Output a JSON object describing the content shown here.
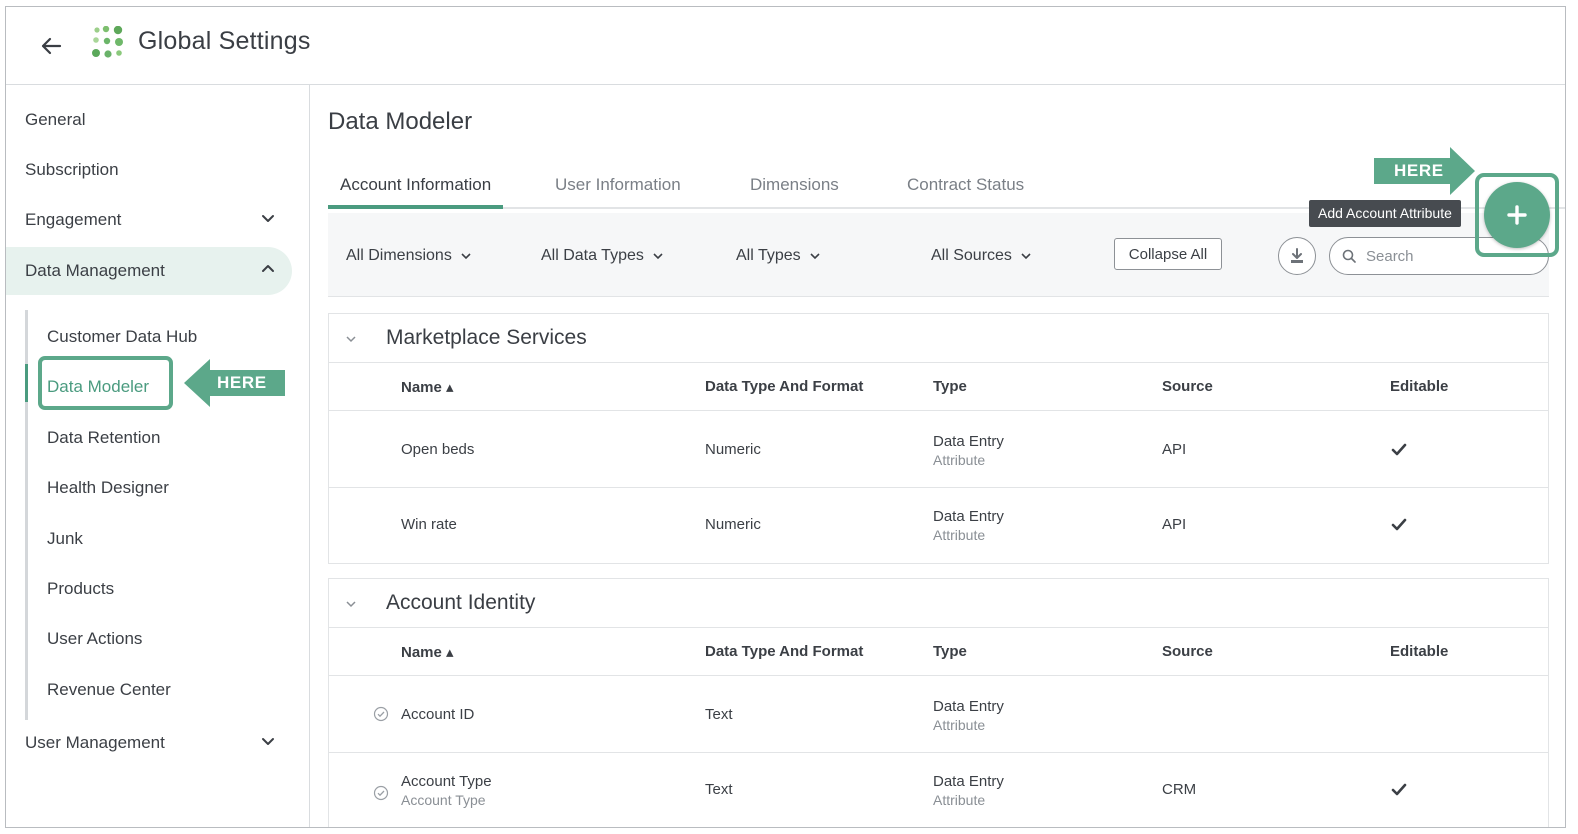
{
  "header": {
    "title": "Global Settings"
  },
  "sidebar": {
    "items": [
      {
        "label": "General"
      },
      {
        "label": "Subscription"
      },
      {
        "label": "Engagement"
      },
      {
        "label": "Data Management"
      },
      {
        "label": "User Management"
      }
    ],
    "sub_items": [
      {
        "label": "Customer Data Hub"
      },
      {
        "label": "Data Modeler"
      },
      {
        "label": "Data Retention"
      },
      {
        "label": "Health Designer"
      },
      {
        "label": "Junk"
      },
      {
        "label": "Products"
      },
      {
        "label": "User Actions"
      },
      {
        "label": "Revenue Center"
      }
    ],
    "callout": "HERE"
  },
  "main": {
    "title": "Data Modeler",
    "tabs": [
      {
        "label": "Account Information"
      },
      {
        "label": "User Information"
      },
      {
        "label": "Dimensions"
      },
      {
        "label": "Contract Status"
      }
    ],
    "filters": [
      {
        "label": "All Dimensions"
      },
      {
        "label": "All Data Types"
      },
      {
        "label": "All Types"
      },
      {
        "label": "All Sources"
      }
    ],
    "collapse_label": "Collapse All",
    "search_placeholder": "Search",
    "tooltip": "Add Account Attribute",
    "fab_label": "+",
    "callout": "HERE",
    "columns": {
      "name": "Name",
      "data_type": "Data Type And Format",
      "type": "Type",
      "source": "Source",
      "editable": "Editable"
    },
    "sections": [
      {
        "title": "Marketplace Services",
        "rows": [
          {
            "name": "Open beds",
            "name_sub": "",
            "data_type": "Numeric",
            "type": "Data Entry",
            "type_sub": "Attribute",
            "source": "API",
            "editable": true
          },
          {
            "name": "Win rate",
            "name_sub": "",
            "data_type": "Numeric",
            "type": "Data Entry",
            "type_sub": "Attribute",
            "source": "API",
            "editable": true
          }
        ]
      },
      {
        "title": "Account Identity",
        "rows": [
          {
            "name": "Account ID",
            "name_sub": "",
            "data_type": "Text",
            "type": "Data Entry",
            "type_sub": "Attribute",
            "source": "",
            "editable": false
          },
          {
            "name": "Account Type",
            "name_sub": "Account Type",
            "data_type": "Text",
            "type": "Data Entry",
            "type_sub": "Attribute",
            "source": "CRM",
            "editable": true
          }
        ]
      }
    ]
  },
  "colors": {
    "accent": "#4a9b7f",
    "highlight": "#5ca88a",
    "active_bg": "#e7f2ee",
    "tooltip_bg": "#474b50"
  }
}
